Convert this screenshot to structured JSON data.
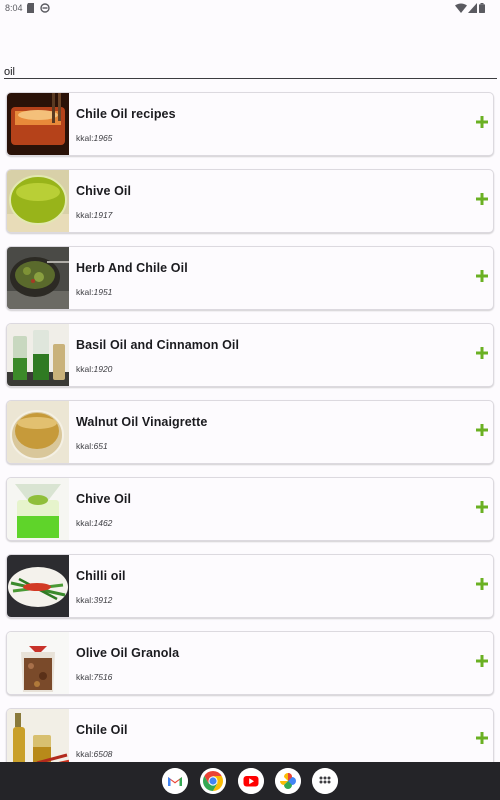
{
  "status_bar": {
    "time": "8:04"
  },
  "search": {
    "value": "oil"
  },
  "kcal_label": "kkal:",
  "recipes": [
    {
      "title": "Chile Oil recipes",
      "kcal": "1965"
    },
    {
      "title": "Chive Oil",
      "kcal": "1917"
    },
    {
      "title": "Herb And Chile Oil",
      "kcal": "1951"
    },
    {
      "title": "Basil Oil and Cinnamon Oil",
      "kcal": "1920"
    },
    {
      "title": "Walnut Oil Vinaigrette",
      "kcal": "651"
    },
    {
      "title": "Chive Oil",
      "kcal": "1462"
    },
    {
      "title": "Chilli oil",
      "kcal": "3912"
    },
    {
      "title": "Olive Oil Granola",
      "kcal": "7516"
    },
    {
      "title": "Chile Oil",
      "kcal": "6508"
    }
  ],
  "colors": {
    "accent": "#6ab023",
    "card_border": "#dcd9df",
    "nav_bar": "#242428"
  },
  "dock": [
    "gmail-icon",
    "chrome-icon",
    "youtube-icon",
    "photos-icon",
    "app-drawer-icon"
  ]
}
